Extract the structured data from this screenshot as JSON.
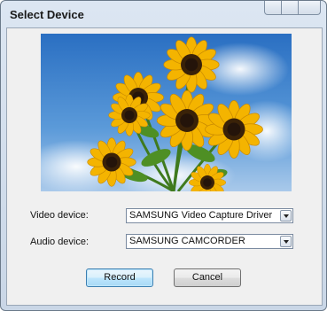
{
  "window": {
    "title": "Select Device"
  },
  "preview": {
    "description_icon": "sunflower-preview-image"
  },
  "video_device": {
    "label": "Video device:",
    "value": "SAMSUNG Video Capture Driver"
  },
  "audio_device": {
    "label": "Audio device:",
    "value": "SAMSUNG CAMCORDER"
  },
  "buttons": {
    "record": "Record",
    "cancel": "Cancel"
  },
  "colors": {
    "accent": "#3c7fb1",
    "sky": "#2f76c7",
    "petal": "#f2b705"
  }
}
